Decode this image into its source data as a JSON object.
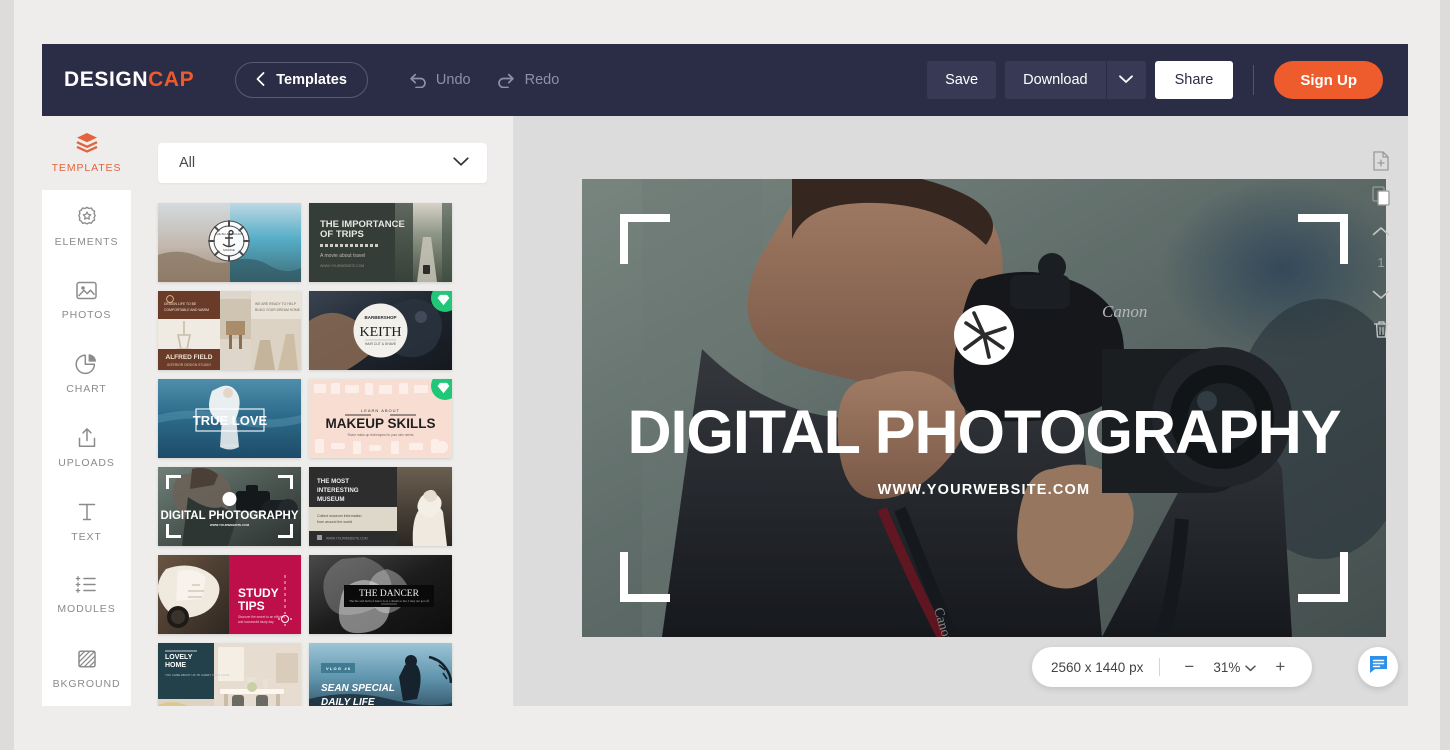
{
  "header": {
    "logo_design": "DESIGN",
    "logo_cap": "CAP",
    "templates_button": "Templates",
    "back_chevron": "‹",
    "undo": "Undo",
    "redo": "Redo",
    "save": "Save",
    "download": "Download",
    "share": "Share",
    "signup": "Sign Up",
    "accent_color": "#ee5b2c",
    "bar_color": "#2b2c45"
  },
  "sidebar": {
    "items": [
      {
        "label": "TEMPLATES",
        "icon": "layers-icon",
        "active": true
      },
      {
        "label": "ELEMENTS",
        "icon": "badge-star-icon",
        "active": false
      },
      {
        "label": "PHOTOS",
        "icon": "image-icon",
        "active": false
      },
      {
        "label": "CHART",
        "icon": "pie-chart-icon",
        "active": false
      },
      {
        "label": "UPLOADS",
        "icon": "upload-icon",
        "active": false
      },
      {
        "label": "TEXT",
        "icon": "text-t-icon",
        "active": false
      },
      {
        "label": "MODULES",
        "icon": "list-icon",
        "active": false
      },
      {
        "label": "BKGROUND",
        "icon": "background-icon",
        "active": false
      }
    ]
  },
  "templates_panel": {
    "filter_value": "All",
    "filter_caret": "chevron-down-icon",
    "items": [
      {
        "name": "blue-sea-anchor",
        "title": "BLUE SEA",
        "premium": false
      },
      {
        "name": "importance-of-trips",
        "title": "THE IMPORTANCE OF TRIPS",
        "subtitle": "A movie about travel",
        "premium": false
      },
      {
        "name": "alfred-field-interior",
        "title": "ALFRED FIELD",
        "premium": false
      },
      {
        "name": "keith-barber",
        "title": "KEITH",
        "premium": true
      },
      {
        "name": "true-love",
        "title": "TRUE LOVE",
        "premium": false
      },
      {
        "name": "makeup-skills",
        "title": "MAKEUP SKILLS",
        "premium": true
      },
      {
        "name": "digital-photography",
        "title": "DIGITAL PHOTOGRAPHY",
        "premium": false
      },
      {
        "name": "most-interesting-museum",
        "title": "THE MOST INTERESTING MUSEUM",
        "subtitle": "Collect museum information from around the world",
        "premium": false
      },
      {
        "name": "study-tips",
        "title": "STUDY TIPS",
        "premium": false
      },
      {
        "name": "the-dancer",
        "title": "THE DANCER",
        "premium": false
      },
      {
        "name": "lovely-home",
        "title": "LOVELY HOME",
        "premium": false
      },
      {
        "name": "sean-special-daily-life",
        "title": "SEAN SPECIAL DAILY LIFE",
        "subtitle": "VLOG #6",
        "premium": false
      }
    ]
  },
  "canvas": {
    "design_title": "DIGITAL PHOTOGRAPHY",
    "design_url": "WWW.YOURWEBSITE.COM",
    "logo_icon": "aperture-icon",
    "page_number": "1",
    "tools": [
      {
        "name": "add-page-icon"
      },
      {
        "name": "duplicate-page-icon"
      },
      {
        "name": "move-up-icon"
      },
      {
        "name": "move-down-icon"
      },
      {
        "name": "delete-page-icon"
      }
    ]
  },
  "zoombar": {
    "dimensions": "2560 x 1440 px",
    "minus": "−",
    "zoom_level": "31%",
    "plus": "+",
    "chat_icon": "chat-bubble-icon",
    "chat_color": "#2e90e8"
  }
}
